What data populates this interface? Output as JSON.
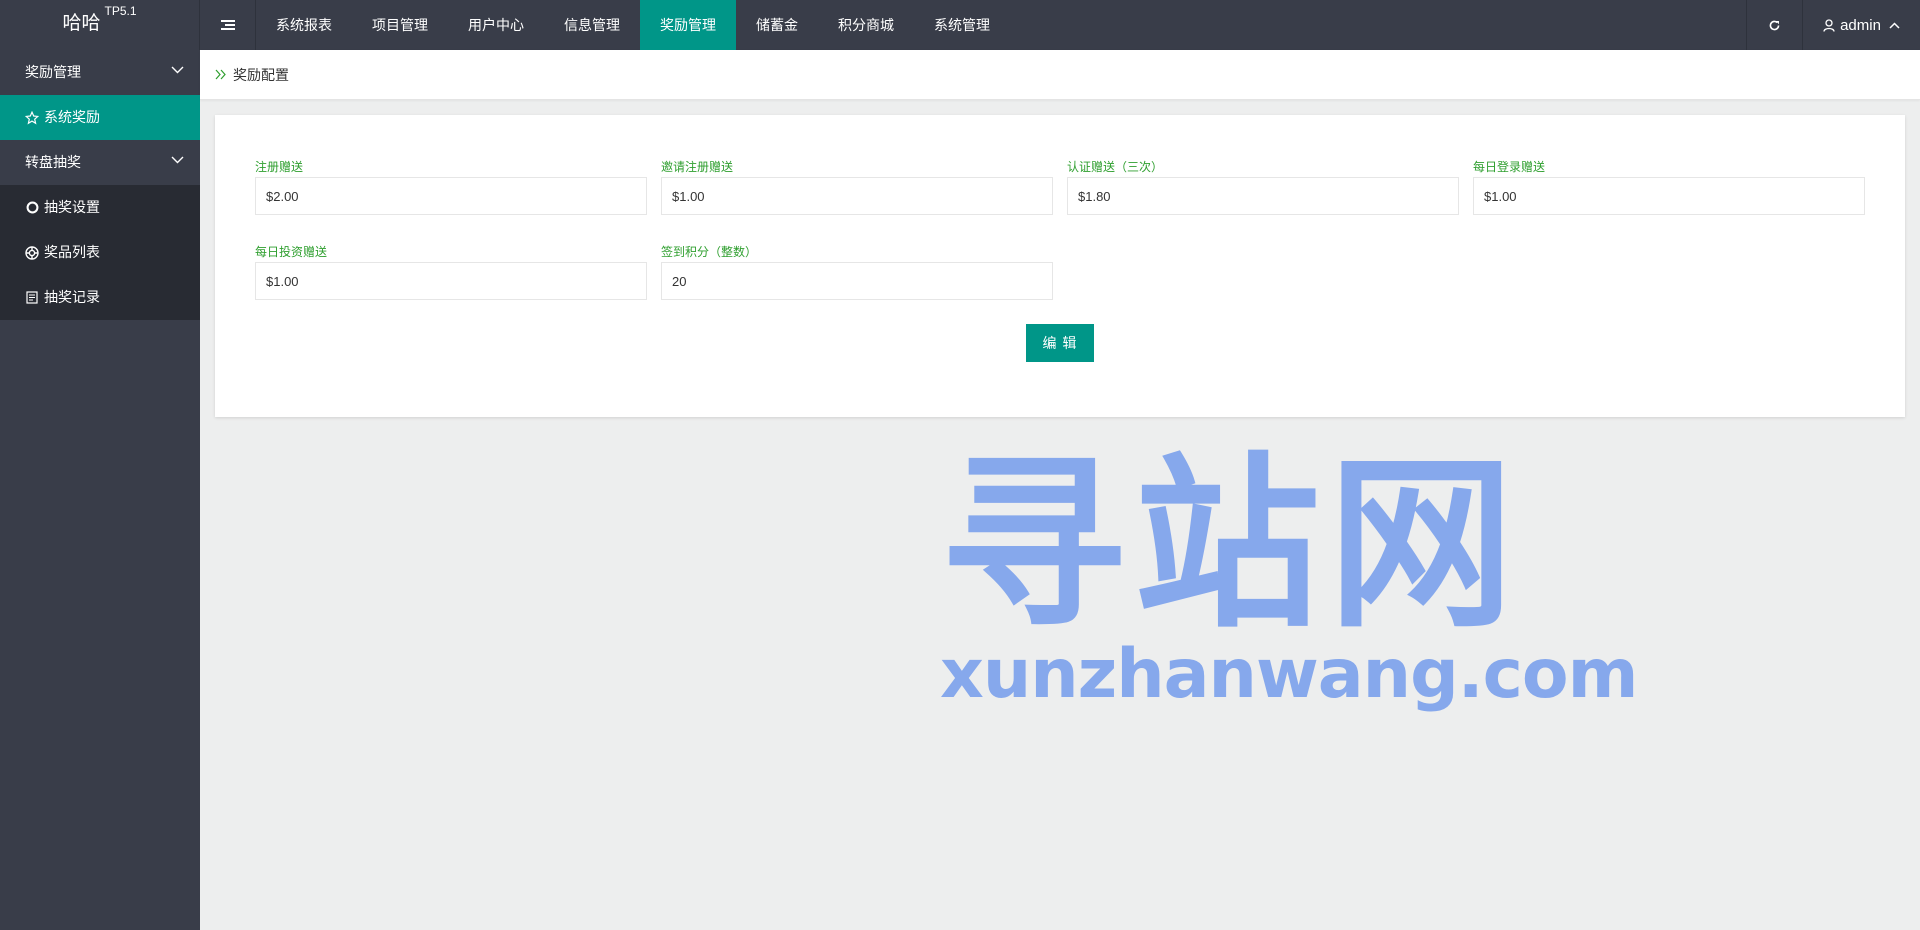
{
  "header": {
    "logo": "哈哈",
    "logo_badge": "TP5.1",
    "nav": [
      {
        "label": "系统报表",
        "active": false
      },
      {
        "label": "项目管理",
        "active": false
      },
      {
        "label": "用户中心",
        "active": false
      },
      {
        "label": "信息管理",
        "active": false
      },
      {
        "label": "奖励管理",
        "active": true
      },
      {
        "label": "储蓄金",
        "active": false
      },
      {
        "label": "积分商城",
        "active": false
      },
      {
        "label": "系统管理",
        "active": false
      }
    ],
    "user": "admin",
    "icons": {
      "menu": "menu-toggle-icon",
      "refresh": "refresh-icon",
      "user": "user-icon",
      "caret": "chevron-up-icon"
    }
  },
  "sidebar": {
    "groups": [
      {
        "label": "奖励管理",
        "items": [
          {
            "label": "系统奖励",
            "icon": "star-icon",
            "active": true
          }
        ]
      },
      {
        "label": "转盘抽奖",
        "items": [
          {
            "label": "抽奖设置",
            "icon": "circle-icon",
            "active": false
          },
          {
            "label": "奖品列表",
            "icon": "lifebuoy-icon",
            "active": false
          },
          {
            "label": "抽奖记录",
            "icon": "document-icon",
            "active": false
          }
        ]
      }
    ]
  },
  "breadcrumb": {
    "label": "奖励配置"
  },
  "form": {
    "fields": [
      {
        "label": "注册赠送",
        "value": "$2.00"
      },
      {
        "label": "邀请注册赠送",
        "value": "$1.00"
      },
      {
        "label": "认证赠送（三次）",
        "value": "$1.80"
      },
      {
        "label": "每日登录赠送",
        "value": "$1.00"
      },
      {
        "label": "每日投资赠送",
        "value": "$1.00"
      },
      {
        "label": "签到积分（整数）",
        "value": "20"
      }
    ],
    "submit_label": "编 辑"
  },
  "watermark": {
    "cn": "寻站网",
    "en": "xunzhanwang.com"
  },
  "colors": {
    "header_bg": "#393d49",
    "accent": "#009688",
    "label_green": "#2f9f2f",
    "watermark": "#86a8ec"
  }
}
